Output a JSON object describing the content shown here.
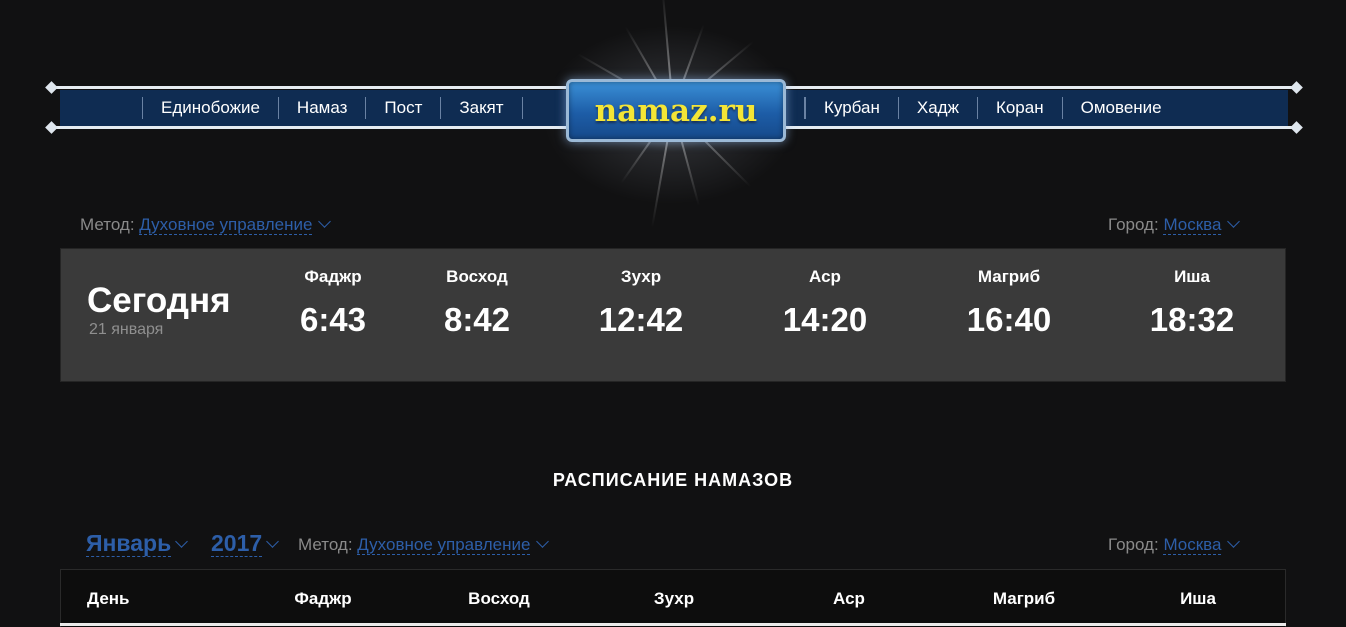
{
  "header": {
    "logo_text": "namaz.ru",
    "nav_left": [
      "Единобожие",
      "Намаз",
      "Пост",
      "Закят"
    ],
    "nav_right": [
      "Курбан",
      "Хадж",
      "Коран",
      "Омовение"
    ]
  },
  "top_selectors": {
    "method_label": "Метод:",
    "method_value": "Духовное управление",
    "city_label": "Город:",
    "city_value": "Москва"
  },
  "today": {
    "title": "Сегодня",
    "date": "21 января",
    "prayers": [
      {
        "name": "Фаджр",
        "time": "6:43"
      },
      {
        "name": "Восход",
        "time": "8:42"
      },
      {
        "name": "Зухр",
        "time": "12:42"
      },
      {
        "name": "Аср",
        "time": "14:20"
      },
      {
        "name": "Магриб",
        "time": "16:40"
      },
      {
        "name": "Иша",
        "time": "18:32"
      }
    ]
  },
  "schedule": {
    "title": "РАСПИСАНИЕ НАМАЗОВ",
    "month": "Январь",
    "year": "2017",
    "method_label": "Метод:",
    "method_value": "Духовное управление",
    "city_label": "Город:",
    "city_value": "Москва",
    "columns": [
      "День",
      "Фаджр",
      "Восход",
      "Зухр",
      "Аср",
      "Магриб",
      "Иша"
    ]
  },
  "colors": {
    "background": "#111112",
    "nav_bar": "#0f2c52",
    "link": "#2d5ea8",
    "logo_text": "#f4e536",
    "panel": "#3a3a3a"
  }
}
